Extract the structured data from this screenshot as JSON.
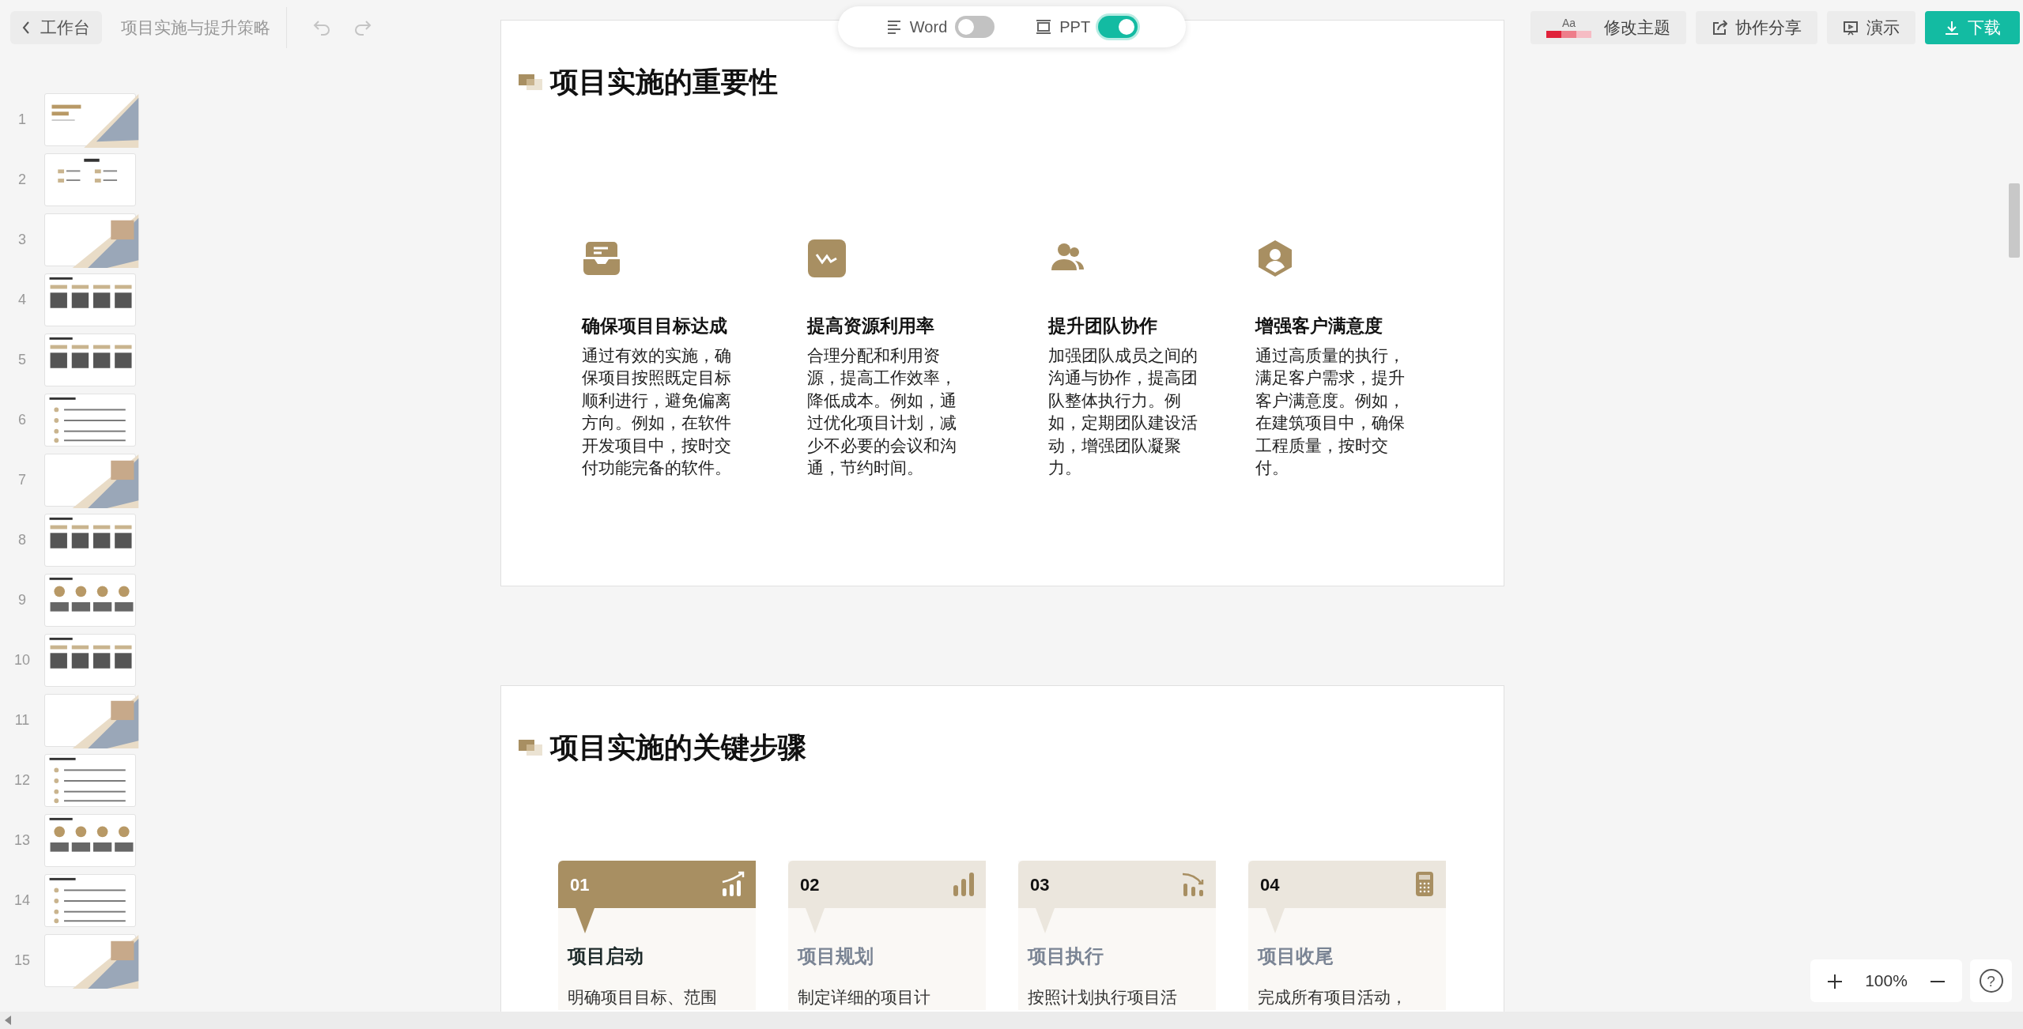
{
  "toolbar": {
    "back_label": "工作台",
    "doc_title": "项目实施与提升策略",
    "undo_disabled": true,
    "redo_disabled": true
  },
  "view_toggle": [
    {
      "label": "Word",
      "kind": "word",
      "on": false
    },
    {
      "label": "PPT",
      "kind": "ppt",
      "on": true
    }
  ],
  "actions": [
    {
      "label": "修改主题",
      "kind": "theme",
      "sample": "Aa"
    },
    {
      "label": "协作分享",
      "kind": "share"
    },
    {
      "label": "演示",
      "kind": "present"
    },
    {
      "label": "下载",
      "kind": "download"
    }
  ],
  "thumbnails": [
    {
      "number": "1",
      "kind": "cover"
    },
    {
      "number": "2",
      "kind": "contents"
    },
    {
      "number": "3",
      "kind": "photo"
    },
    {
      "number": "4",
      "kind": "columns"
    },
    {
      "number": "5",
      "kind": "columns"
    },
    {
      "number": "6",
      "kind": "list"
    },
    {
      "number": "7",
      "kind": "photo"
    },
    {
      "number": "8",
      "kind": "columns"
    },
    {
      "number": "9",
      "kind": "circles"
    },
    {
      "number": "10",
      "kind": "columns"
    },
    {
      "number": "11",
      "kind": "photo"
    },
    {
      "number": "12",
      "kind": "list"
    },
    {
      "number": "13",
      "kind": "circles"
    },
    {
      "number": "14",
      "kind": "list"
    },
    {
      "number": "15",
      "kind": "photo"
    }
  ],
  "slides": [
    {
      "title": "项目实施的重要性",
      "kind": "features",
      "items": [
        {
          "title": "确保项目目标达成",
          "text": "通过有效的实施，确保项目按照既定目标顺利进行，避免偏离方向。例如，在软件开发项目中，按时交付功能完备的软件。"
        },
        {
          "title": "提高资源利用率",
          "text": "合理分配和利用资源，提高工作效率，降低成本。例如，通过优化项目计划，减少不必要的会议和沟通，节约时间。"
        },
        {
          "title": "提升团队协作",
          "text": "加强团队成员之间的沟通与协作，提高团队整体执行力。例如，定期团队建设活动，增强团队凝聚力。"
        },
        {
          "title": "增强客户满意度",
          "text": "通过高质量的执行，满足客户需求，提升客户满意度。例如，在建筑项目中，确保工程质量，按时交付。"
        }
      ]
    },
    {
      "title": "项目实施的关键步骤",
      "kind": "steps",
      "items": [
        {
          "number": "01",
          "title": "项目启动",
          "text": "明确项目目标、范围",
          "active": true
        },
        {
          "number": "02",
          "title": "项目规划",
          "text": "制定详细的项目计",
          "active": false
        },
        {
          "number": "03",
          "title": "项目执行",
          "text": "按照计划执行项目活",
          "active": false
        },
        {
          "number": "04",
          "title": "项目收尾",
          "text": "完成所有项目活动，",
          "active": false
        }
      ]
    }
  ],
  "zoom": {
    "level": "100%"
  },
  "help": "?"
}
